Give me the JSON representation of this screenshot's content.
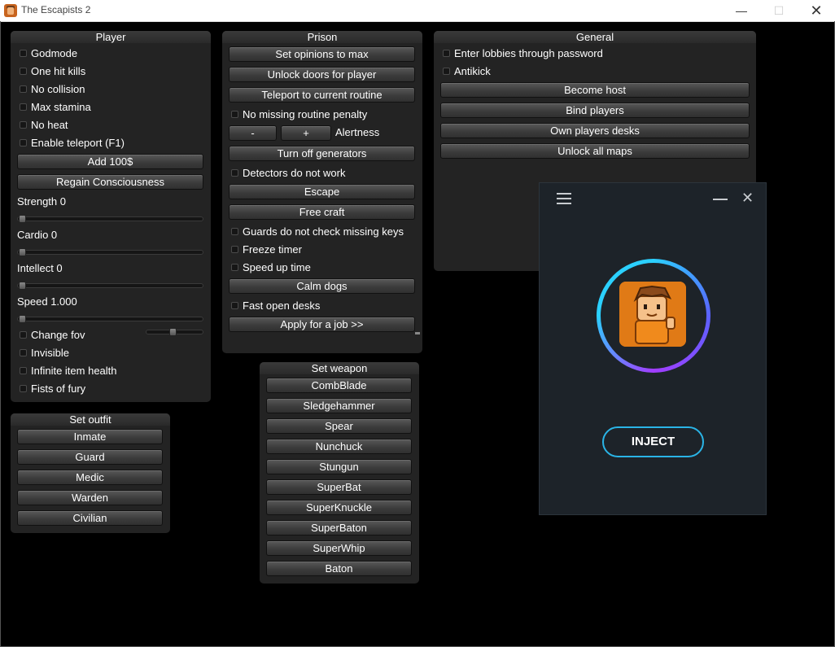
{
  "window": {
    "title": "The Escapists 2"
  },
  "player": {
    "title": "Player",
    "checkboxes_top": [
      "Godmode",
      "One hit kills",
      "No collision",
      "Max stamina",
      "No heat",
      "Enable teleport (F1)"
    ],
    "buttons": [
      "Add 100$",
      "Regain Consciousness"
    ],
    "sliders": [
      {
        "label": "Strength 0",
        "value": 0
      },
      {
        "label": "Cardio 0",
        "value": 0
      },
      {
        "label": "Intellect 0",
        "value": 0
      },
      {
        "label": "Speed 1.000",
        "value": 0
      }
    ],
    "fov_label": "Change fov",
    "fov_value": 0.15,
    "checkboxes_bottom": [
      "Invisible",
      "Infinite item health",
      "Fists of fury"
    ]
  },
  "prison": {
    "title": "Prison",
    "set_opinions": "Set opinions to max",
    "unlock_doors": "Unlock doors for player",
    "teleport_routine": "Teleport to current routine",
    "no_missing_penalty": "No missing routine penalty",
    "alert_minus": "-",
    "alert_plus": "+",
    "alertness": "Alertness",
    "turn_off_generators": "Turn off generators",
    "detectors": "Detectors do not work",
    "escape": "Escape",
    "free_craft": "Free craft",
    "guards_keys": "Guards do not check missing keys",
    "freeze_timer": "Freeze timer",
    "speed_up": "Speed up time",
    "calm_dogs": "Calm dogs",
    "fast_desks": "Fast open desks",
    "apply_job": "Apply for a job >>"
  },
  "general": {
    "title": "General",
    "lobbies": "Enter lobbies through password",
    "antikick": "Antikick",
    "buttons": [
      "Become host",
      "Bind players",
      "Own players desks",
      "Unlock all maps"
    ]
  },
  "outfit": {
    "title": "Set outfit",
    "items": [
      "Inmate",
      "Guard",
      "Medic",
      "Warden",
      "Civilian"
    ]
  },
  "weapon": {
    "title": "Set weapon",
    "items": [
      "CombBlade",
      "Sledgehammer",
      "Spear",
      "Nunchuck",
      "Stungun",
      "SuperBat",
      "SuperKnuckle",
      "SuperBaton",
      "SuperWhip",
      "Baton"
    ]
  },
  "injector": {
    "inject_label": "INJECT"
  },
  "colors": {
    "panel_bg": "#232323",
    "injector_bg": "#1d2329",
    "accent_blue": "#2ab4e6",
    "accent_green": "#1fa83a"
  }
}
